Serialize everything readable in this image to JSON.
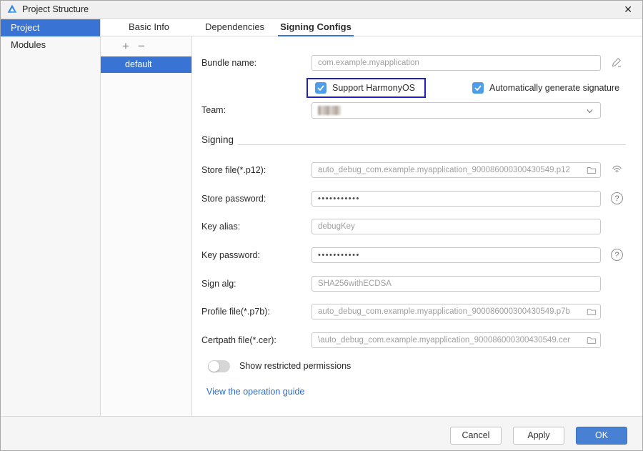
{
  "titlebar": {
    "title": "Project Structure",
    "close_icon": "✕"
  },
  "sidebar": {
    "items": [
      {
        "label": "Project",
        "selected": true
      },
      {
        "label": "Modules",
        "selected": false
      }
    ]
  },
  "tabs": {
    "items": [
      {
        "label": "Basic Info"
      },
      {
        "label": "Dependencies"
      },
      {
        "label": "Signing Configs"
      }
    ],
    "selected": "Signing Configs"
  },
  "config_panel": {
    "add_icon": "+",
    "remove_icon": "−",
    "items": [
      {
        "label": "default",
        "selected": true
      }
    ]
  },
  "form": {
    "bundle_name": {
      "label": "Bundle name:",
      "value": "com.example.myapplication"
    },
    "support_harmonyos": {
      "label": "Support HarmonyOS",
      "checked": true
    },
    "auto_generate_signature": {
      "label": "Automatically generate signature",
      "checked": true
    },
    "team": {
      "label": "Team:",
      "value_redacted": true
    },
    "signing_section_title": "Signing",
    "store_file": {
      "label": "Store file(*.p12):",
      "value": "auto_debug_com.example.myapplication_900086000300430549.p12"
    },
    "store_password": {
      "label": "Store password:",
      "value": "•••••••••••"
    },
    "key_alias": {
      "label": "Key alias:",
      "value": "debugKey"
    },
    "key_password": {
      "label": "Key password:",
      "value": "•••••••••••"
    },
    "sign_alg": {
      "label": "Sign alg:",
      "value": "SHA256withECDSA"
    },
    "profile_file": {
      "label": "Profile file(*.p7b):",
      "value": "auto_debug_com.example.myapplication_900086000300430549.p7b"
    },
    "certpath_file": {
      "label": "Certpath file(*.cer):",
      "value": "\\auto_debug_com.example.myapplication_900086000300430549.cer"
    },
    "show_restricted_permissions": {
      "label": "Show restricted permissions",
      "on": false
    },
    "guide_link": "View the operation guide",
    "help_icon": "?"
  },
  "footer": {
    "cancel": "Cancel",
    "apply": "Apply",
    "ok": "OK"
  },
  "colors": {
    "selection_blue": "#3974d4",
    "checkbox_blue": "#4d9de9",
    "highlight_border": "#1f1fc8",
    "ok_blue": "#4880d4",
    "link_blue": "#2d6bc9"
  }
}
